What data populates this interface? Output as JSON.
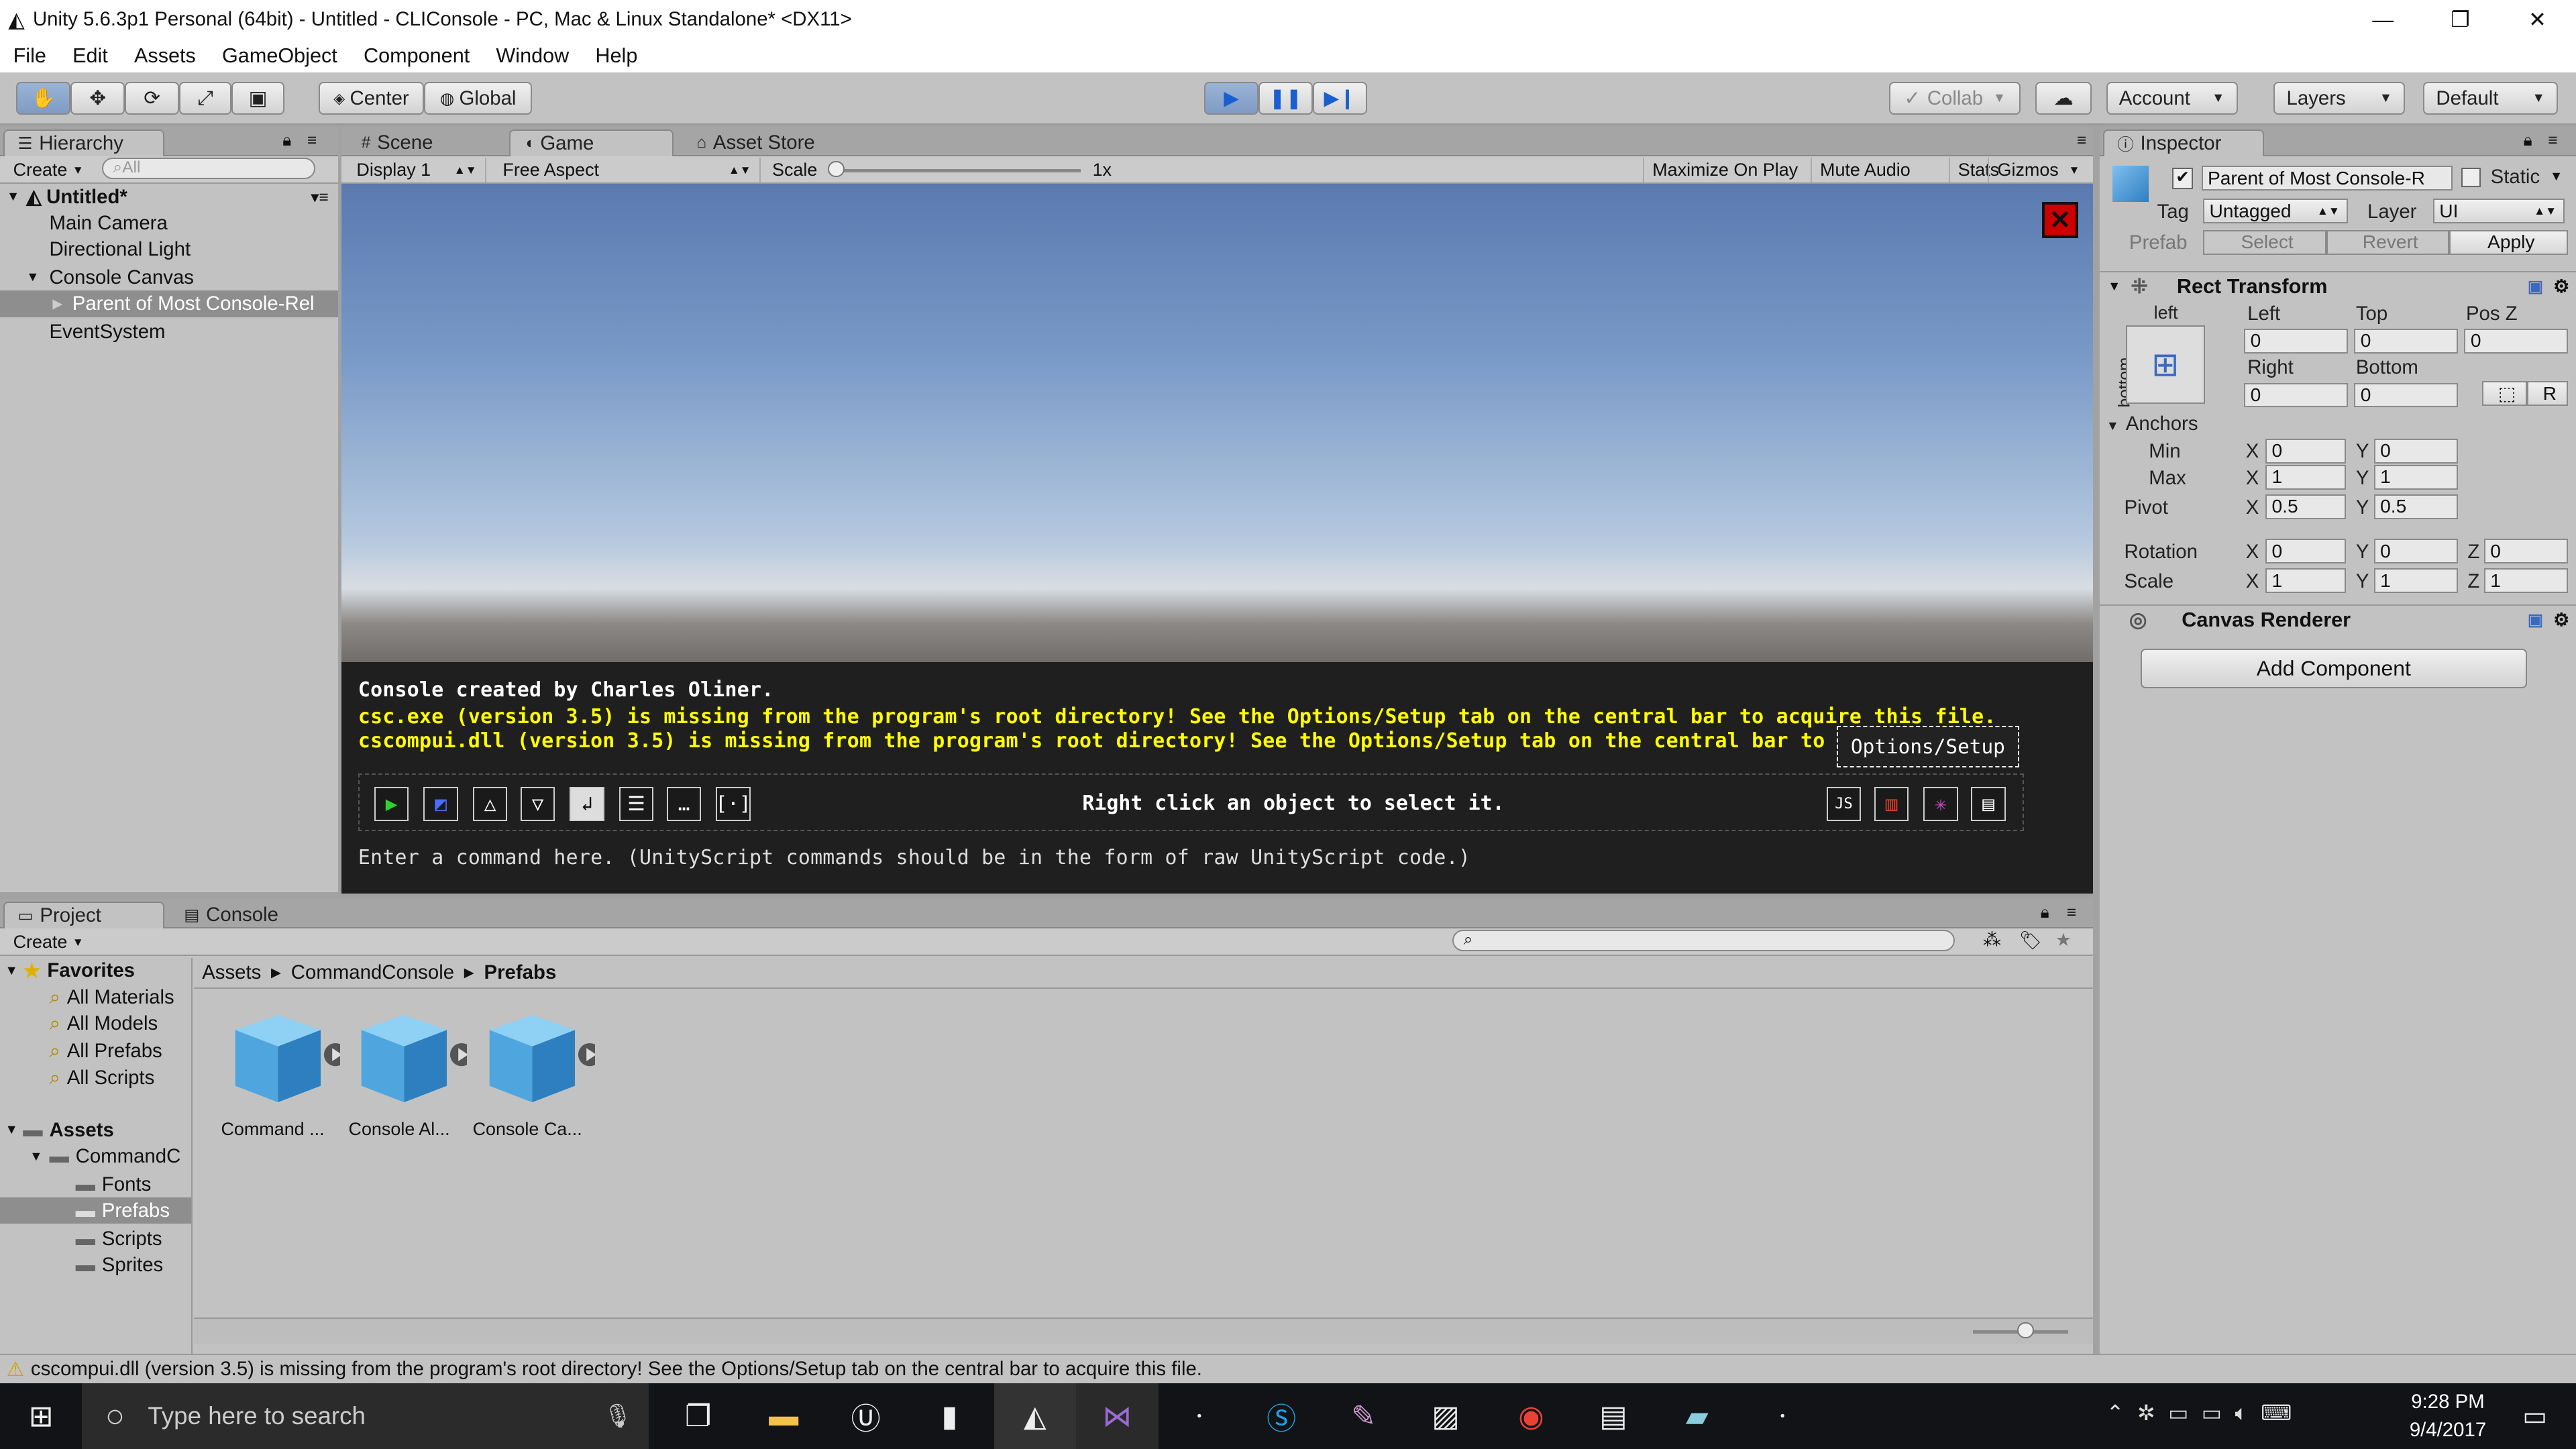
{
  "window": {
    "title": "Unity 5.6.3p1 Personal (64bit) - Untitled - CLIConsole - PC, Mac & Linux Standalone* <DX11>",
    "minimize_icon": "minimize-icon",
    "restore_icon": "restore-icon",
    "close_icon": "close-icon"
  },
  "menu": [
    "File",
    "Edit",
    "Assets",
    "GameObject",
    "Component",
    "Window",
    "Help"
  ],
  "toolbar": {
    "center_label": "Center",
    "global_label": "Global",
    "collab_label": "Collab",
    "account_label": "Account",
    "layers_label": "Layers",
    "layout_label": "Default",
    "play_state": "playing"
  },
  "hierarchy": {
    "tab": "Hierarchy",
    "create": "Create",
    "search_placeholder": "All",
    "scene": "Untitled*",
    "items": [
      "Main Camera",
      "Directional Light",
      "Console Canvas",
      "Parent of Most Console-Rel",
      "EventSystem"
    ]
  },
  "center_tabs": {
    "scene": "Scene",
    "game": "Game",
    "asset_store": "Asset Store"
  },
  "game_bar": {
    "display": "Display 1",
    "aspect": "Free Aspect",
    "scale_label": "Scale",
    "scale_value": "1x",
    "maximize": "Maximize On Play",
    "mute": "Mute Audio",
    "stats": "Stats",
    "gizmos": "Gizmos"
  },
  "console": {
    "line1": "Console created by Charles Oliner.",
    "line2": "csc.exe (version 3.5) is missing from the program's root directory! See the Options/Setup tab on the central bar to acquire this file.",
    "line3": "cscompui.dll (version 3.5) is missing from the program's root directory! See the Options/Setup tab on the central bar to acqui",
    "tooltip": "Options/Setup",
    "hint": "Right click an object to select it.",
    "input_placeholder": "Enter a command here. (UnityScript commands should be in the form of raw UnityScript code.)",
    "text_color": "#ffff00",
    "left_buttons": [
      "play-icon",
      "edit-icon",
      "triangle-up-icon",
      "triangle-down-icon",
      "enter-icon",
      "list-icon",
      "ellipsis-icon",
      "bracket-icon"
    ],
    "right_buttons": [
      "js-icon",
      "bars-icon",
      "color-icon",
      "options-icon"
    ]
  },
  "inspector": {
    "tab": "Inspector",
    "object_name": "Parent of Most Console-R",
    "static_label": "Static",
    "tag_label": "Tag",
    "tag_value": "Untagged",
    "layer_label": "Layer",
    "layer_value": "UI",
    "prefab_label": "Prefab",
    "select_label": "Select",
    "revert_label": "Revert",
    "apply_label": "Apply",
    "rect_transform": "Rect Transform",
    "anchor_h": "left",
    "anchor_v": "bottom",
    "left_label": "Left",
    "top_label": "Top",
    "posz_label": "Pos Z",
    "left": "0",
    "top": "0",
    "posz": "0",
    "right_label": "Right",
    "bottom_label": "Bottom",
    "right": "0",
    "bottom": "0",
    "r_label": "R",
    "anchors_label": "Anchors",
    "min_label": "Min",
    "max_label": "Max",
    "pivot_label": "Pivot",
    "rotation_label": "Rotation",
    "scale_label": "Scale",
    "x": "X",
    "y": "Y",
    "z": "Z",
    "min_x": "0",
    "min_y": "0",
    "max_x": "1",
    "max_y": "1",
    "pivot_x": "0.5",
    "pivot_y": "0.5",
    "rot_x": "0",
    "rot_y": "0",
    "rot_z": "0",
    "scale_x": "1",
    "scale_y": "1",
    "scale_z": "1",
    "canvas_renderer": "Canvas Renderer",
    "add_component": "Add Component"
  },
  "project": {
    "tab_project": "Project",
    "tab_console": "Console",
    "create": "Create",
    "favorites_label": "Favorites",
    "favorites": [
      "All Materials",
      "All Models",
      "All Prefabs",
      "All Scripts"
    ],
    "assets_label": "Assets",
    "folder_root": "CommandC",
    "folders": [
      "Fonts",
      "Prefabs",
      "Scripts",
      "Sprites"
    ],
    "breadcrumb": [
      "Assets",
      "CommandConsole",
      "Prefabs"
    ],
    "assets": [
      "Command ...",
      "Console Al...",
      "Console Ca..."
    ]
  },
  "status_bar": "cscompui.dll (version 3.5) is missing from the program's root directory! See the Options/Setup tab on the central bar to acquire this file.",
  "taskbar": {
    "search_placeholder": "Type here to search",
    "time": "9:28 PM",
    "date": "9/4/2017"
  }
}
